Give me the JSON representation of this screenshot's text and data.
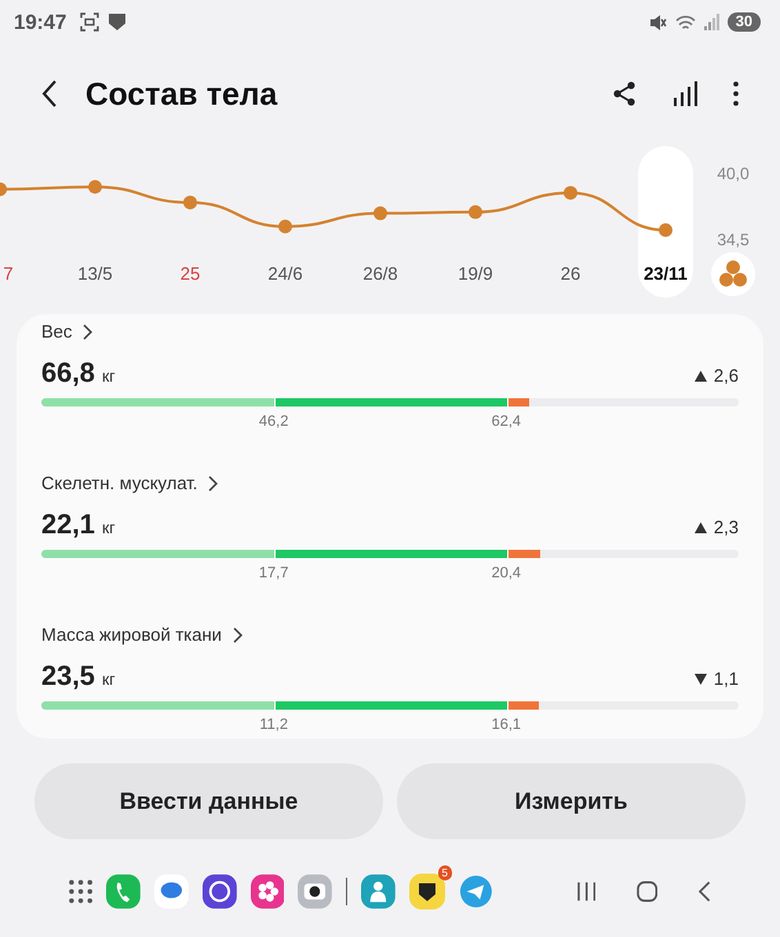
{
  "status_bar": {
    "time": "19:47",
    "battery": "30"
  },
  "header": {
    "title": "Состав тела"
  },
  "chart": {
    "x_label_states": [
      {
        "selected": false,
        "highlight": true
      },
      {
        "selected": false,
        "highlight": false
      },
      {
        "selected": false,
        "highlight": true
      },
      {
        "selected": false,
        "highlight": false
      },
      {
        "selected": false,
        "highlight": false
      },
      {
        "selected": false,
        "highlight": false
      },
      {
        "selected": false,
        "highlight": false
      },
      {
        "selected": true,
        "highlight": false
      }
    ],
    "chart_data": {
      "type": "line",
      "categories": [
        "7",
        "13/5",
        "25",
        "24/6",
        "26/8",
        "19/9",
        "26",
        "23/11"
      ],
      "ylim": [
        34.5,
        40
      ],
      "series": [
        {
          "color": "#d4822f",
          "marker": true,
          "values": [
            38.7,
            38.9,
            37.6,
            35.6,
            36.7,
            36.8,
            38.4,
            35.3
          ]
        }
      ],
      "yticks": [
        {
          "value": 40,
          "label": "40,0"
        },
        {
          "value": 34.5,
          "label": "34,5"
        }
      ]
    }
  },
  "metrics": [
    {
      "name": "Вес",
      "value": "66,8",
      "unit": "кг",
      "kind": "up",
      "delta": "2,6",
      "level": 0.7,
      "low": "46,2",
      "high": "62,4"
    },
    {
      "name": "Скелетн. мускулат.",
      "value": "22,1",
      "unit": "кг",
      "kind": "up",
      "delta": "2,3",
      "level": 0.715,
      "low": "17,7",
      "high": "20,4"
    },
    {
      "name": "Масса жировой ткани",
      "value": "23,5",
      "unit": "кг",
      "kind": "down",
      "delta": "1,1",
      "level": 0.713,
      "low": "11,2",
      "high": "16,1"
    }
  ],
  "buttons": [
    "Ввести данные",
    "Измерить"
  ],
  "dock": {
    "badge": "5"
  }
}
